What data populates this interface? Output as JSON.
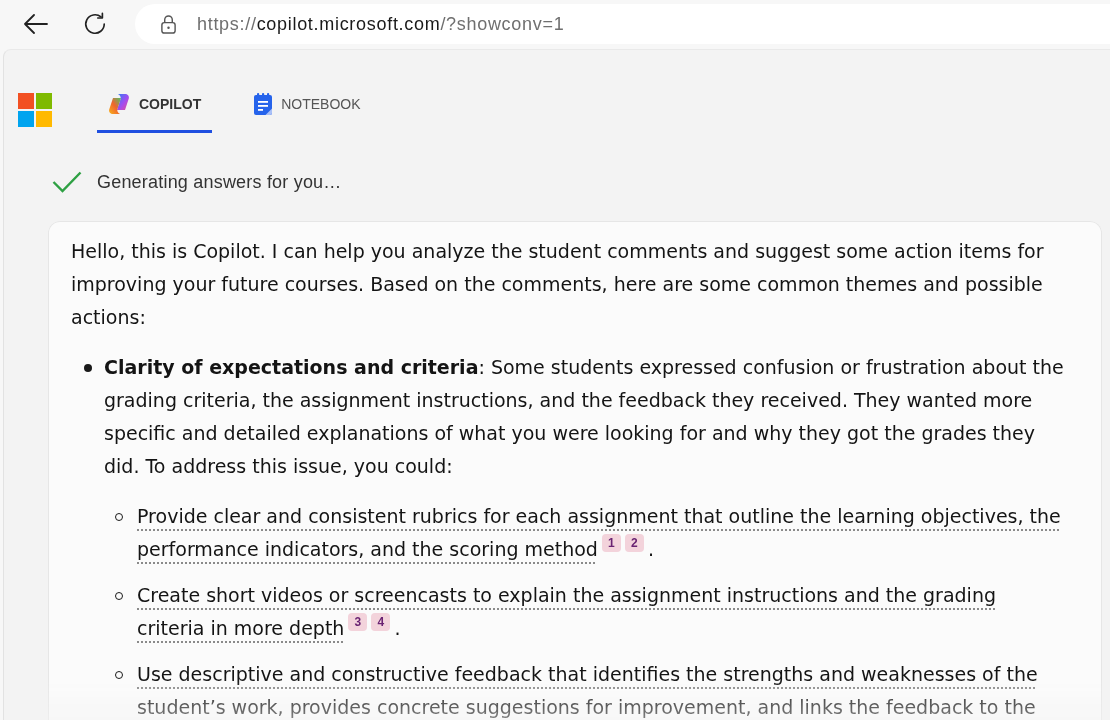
{
  "browser": {
    "url": {
      "scheme": "https://",
      "host": "copilot.microsoft.com",
      "path": "/?showconv=1"
    }
  },
  "tabs": [
    {
      "kind": "copilot",
      "label": "COPILOT",
      "selected": true
    },
    {
      "kind": "notebook",
      "label": "NOTEBOOK",
      "selected": false
    }
  ],
  "status": {
    "text": "Generating answers for you…"
  },
  "answer": {
    "intro": "Hello, this is Copilot. I can help you analyze the student comments and suggest some action items for improving your future courses. Based on the comments, here are some common themes and possible actions:",
    "items": [
      {
        "text": "**Clarity of expectations and criteria**: Some students expressed confusion or frustration about the grading criteria, the assignment instructions, and the feedback they received. They wanted more specific and detailed explanations of what you were looking for and why they got the grades they did. To address this issue, you could:",
        "children": [
          {
            "text": "Provide clear and consistent rubrics for each assignment that outline the learning objectives, the performance indicators, and the scoring method",
            "citations": [
              "1",
              "2"
            ],
            "end": "."
          },
          {
            "text": "Create short videos or screencasts to explain the assignment instructions and the grading criteria in more depth",
            "citations": [
              "3",
              "4"
            ],
            "end": "."
          },
          {
            "text": "Use descriptive and constructive feedback that identifies the strengths and weaknesses of the student’s work, provides concrete suggestions for improvement, and links the feedback to the"
          }
        ]
      }
    ]
  }
}
